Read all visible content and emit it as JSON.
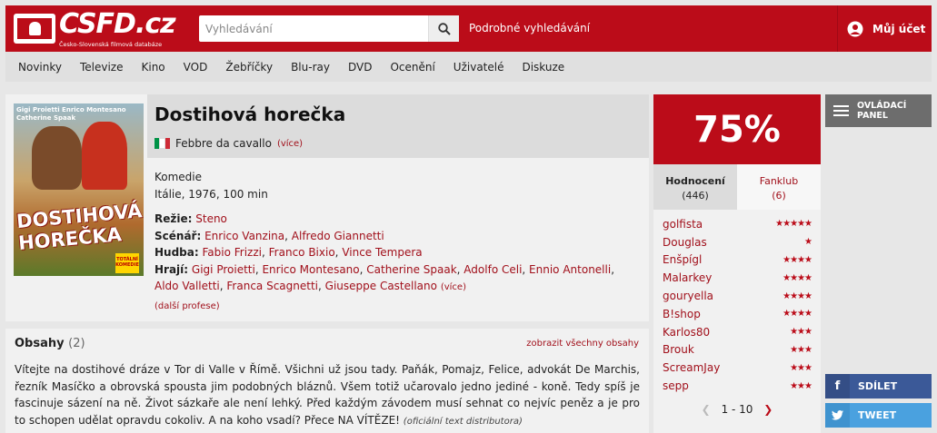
{
  "header": {
    "logo_text": "CSFD.cz",
    "logo_subtitle": "Česko-Slovenská filmová databáze",
    "search_placeholder": "Vyhledávání",
    "advanced_search": "Podrobné vyhledávání",
    "account": "Můj účet"
  },
  "nav": [
    "Novinky",
    "Televize",
    "Kino",
    "VOD",
    "Žebříčky",
    "Blu-ray",
    "DVD",
    "Ocenění",
    "Uživatelé",
    "Diskuze"
  ],
  "film": {
    "title": "Dostihová horečka",
    "original_title": "Febbre da cavallo",
    "more": "(více)",
    "flag_colors": [
      "#009246",
      "#ffffff",
      "#ce2b37"
    ],
    "genre": "Komedie",
    "origin": "Itálie, 1976, 100 min",
    "direction_label": "Režie:",
    "direction": [
      "Steno"
    ],
    "screenplay_label": "Scénář:",
    "screenplay": [
      "Enrico Vanzina",
      "Alfredo Giannetti"
    ],
    "music_label": "Hudba:",
    "music": [
      "Fabio Frizzi",
      "Franco Bixio",
      "Vince Tempera"
    ],
    "cast_label": "Hrají:",
    "cast": [
      "Gigi Proietti",
      "Enrico Montesano",
      "Catherine Spaak",
      "Adolfo Celi",
      "Ennio Antonelli",
      "Aldo Valletti",
      "Franca Scagnetti",
      "Giuseppe Castellano"
    ],
    "cast_more": "(více)",
    "other_professions": "(další profese)",
    "poster": {
      "names": "Gigi Proietti  Enrico Montesano  Catherine Spaak",
      "title_line1": "DOSTIHOVÁ",
      "title_line2": "HOREČKA",
      "badge": "TOTÁLNÍ KOMEDIE"
    }
  },
  "plot": {
    "heading": "Obsahy",
    "count": "(2)",
    "show_all": "zobrazit všechny obsahy",
    "text": "Vítejte na dostihové dráze v Tor di Valle v Římě. Všichni už jsou tady. Paňák, Pomajz, Felice, advokát De Marchis, řezník Masíčko a obrovská spousta jim podobných bláznů. Všem totiž učarovalo jedno jediné - koně. Tedy spíš je fascinuje sázení na ně. Život sázkaře ale není lehký. Před každým závodem musí sehnat co nejvíc peněz a je pro to schopen udělat opravdu cokoliv. A na koho vsadí? Přece NA VÍTĚZE!",
    "source": "(oficiální text distributora)"
  },
  "rating": {
    "score": "75%",
    "tab_ratings": "Hodnocení",
    "tab_ratings_count": "(446)",
    "tab_fanclub": "Fanklub",
    "tab_fanclub_count": "(6)",
    "users": [
      {
        "name": "golfista",
        "stars": 5
      },
      {
        "name": "Douglas",
        "stars": 1
      },
      {
        "name": "Enšpígl",
        "stars": 4
      },
      {
        "name": "Malarkey",
        "stars": 4
      },
      {
        "name": "gouryella",
        "stars": 4
      },
      {
        "name": "B!shop",
        "stars": 4
      },
      {
        "name": "Karlos80",
        "stars": 3
      },
      {
        "name": "Brouk",
        "stars": 3
      },
      {
        "name": "ScreamJay",
        "stars": 3
      },
      {
        "name": "sepp",
        "stars": 3
      }
    ],
    "pager": "1 - 10"
  },
  "side": {
    "control_panel": "OVLÁDACÍ PANEL",
    "share": "SDÍLET",
    "tweet": "TWEET"
  },
  "colors": {
    "brand_red": "#bb0c19",
    "link_red": "#a1101b",
    "facebook": "#3b5998",
    "twitter": "#4aa1df"
  }
}
